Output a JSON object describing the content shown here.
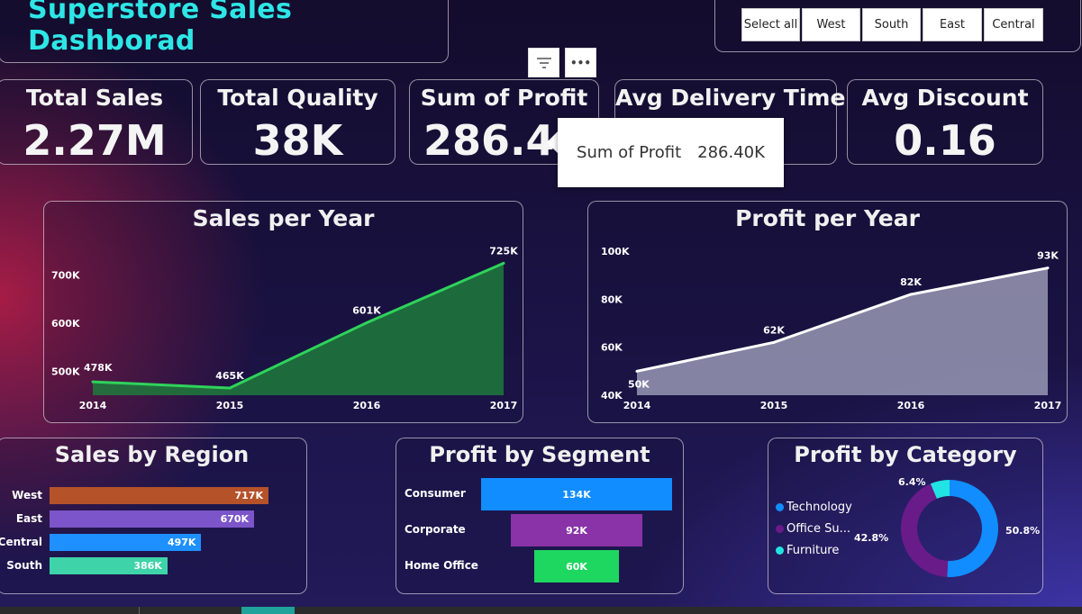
{
  "header": {
    "title": "Superstore Sales Dashborad"
  },
  "region_slicer": {
    "options": [
      "Select all",
      "West",
      "South",
      "East",
      "Central"
    ]
  },
  "toolbar": {
    "filter_icon": "filter-icon",
    "more_icon": "more-options-icon",
    "more_label": "•••"
  },
  "kpis": [
    {
      "label": "Total Sales",
      "value": "2.27M"
    },
    {
      "label": "Total Quality",
      "value": "38K"
    },
    {
      "label": "Sum of Profit",
      "value": "286.40K"
    },
    {
      "label": "Avg Delivery Time",
      "value": ""
    },
    {
      "label": "Avg Discount",
      "value": "0.16"
    }
  ],
  "tooltip": {
    "label": "Sum of Profit",
    "value": "286.40K"
  },
  "sales_per_year": {
    "title": "Sales per Year",
    "y_ticks": [
      "700K",
      "600K",
      "500K"
    ],
    "x": [
      "2014",
      "2015",
      "2016",
      "2017"
    ],
    "labels": [
      "478K",
      "465K",
      "601K",
      "725K"
    ]
  },
  "profit_per_year": {
    "title": "Profit per Year",
    "y_ticks": [
      "100K",
      "80K",
      "60K",
      "40K"
    ],
    "x": [
      "2014",
      "2015",
      "2016",
      "2017"
    ],
    "labels": [
      "50K",
      "62K",
      "82K",
      "93K"
    ]
  },
  "sales_by_region": {
    "title": "Sales by Region",
    "rows": [
      {
        "label": "West",
        "value": "717K",
        "color": "#b5522a"
      },
      {
        "label": "East",
        "value": "670K",
        "color": "#7b55c9"
      },
      {
        "label": "Central",
        "value": "497K",
        "color": "#1e90ff"
      },
      {
        "label": "South",
        "value": "386K",
        "color": "#3ed3a8"
      }
    ]
  },
  "profit_by_segment": {
    "title": "Profit by Segment",
    "rows": [
      {
        "label": "Consumer",
        "value": "134K",
        "color": "#118dff"
      },
      {
        "label": "Corporate",
        "value": "92K",
        "color": "#8a33a8"
      },
      {
        "label": "Home Office",
        "value": "60K",
        "color": "#1ed760"
      }
    ]
  },
  "profit_by_category": {
    "title": "Profit by Category",
    "legend": [
      {
        "label": "Technology",
        "color": "#118dff"
      },
      {
        "label": "Office Su...",
        "color": "#6a1b8a"
      },
      {
        "label": "Furniture",
        "color": "#21e3e3"
      }
    ],
    "slice_labels": [
      "50.8%",
      "42.8%",
      "6.4%"
    ]
  },
  "chart_data": [
    {
      "type": "area",
      "title": "Sales per Year",
      "x": [
        2014,
        2015,
        2016,
        2017
      ],
      "values": [
        478000,
        465000,
        601000,
        725000
      ],
      "ylim": [
        450000,
        750000
      ],
      "color": "#2ed35a"
    },
    {
      "type": "area",
      "title": "Profit per Year",
      "x": [
        2014,
        2015,
        2016,
        2017
      ],
      "values": [
        50000,
        62000,
        82000,
        93000
      ],
      "ylim": [
        40000,
        100000
      ],
      "color": "#ffffff"
    },
    {
      "type": "bar",
      "title": "Sales by Region",
      "categories": [
        "West",
        "East",
        "Central",
        "South"
      ],
      "values": [
        717000,
        670000,
        497000,
        386000
      ]
    },
    {
      "type": "bar",
      "title": "Profit by Segment",
      "categories": [
        "Consumer",
        "Corporate",
        "Home Office"
      ],
      "values": [
        134000,
        92000,
        60000
      ]
    },
    {
      "type": "pie",
      "title": "Profit by Category",
      "categories": [
        "Technology",
        "Office Supplies",
        "Furniture"
      ],
      "values": [
        50.8,
        42.8,
        6.4
      ]
    }
  ]
}
